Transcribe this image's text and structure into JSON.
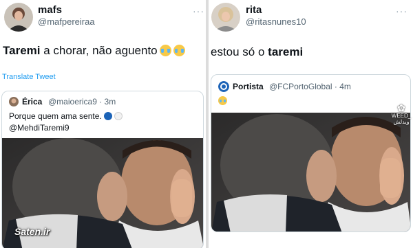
{
  "left_tweet": {
    "author_name": "mafs",
    "author_handle": "@mafpereiraa",
    "more_label": "···",
    "text_bold": "Taremi",
    "text_rest": " a chorar, não aguento",
    "emoji_icons": [
      "loudly-crying-face-icon",
      "loudly-crying-face-icon"
    ],
    "translate_label": "Translate Tweet",
    "quote": {
      "author_name": "Érica",
      "author_handle": "@maioerica9",
      "time": "· 3m",
      "line1": "Porque quem ama sente.",
      "line1_icons": [
        "blue-circle-icon",
        "white-circle-icon"
      ],
      "line2": "@MehdiTaremi9"
    },
    "watermark": "Saten.ir"
  },
  "right_tweet": {
    "author_name": "rita",
    "author_handle": "@ritasnunes10",
    "more_label": "···",
    "text_rest": "estou só o ",
    "text_bold": "taremi",
    "quote": {
      "author_name": "Portista",
      "author_handle": "@FCPortoGlobal",
      "time": "· 4m",
      "icon": "loudly-crying-face-icon"
    },
    "watermark_latin": "WEED_",
    "watermark_script": "ويدلش"
  },
  "colors": {
    "link_blue": "#1d9bf0",
    "secondary_text": "#536471",
    "porto_blue": "#1c63b7"
  }
}
